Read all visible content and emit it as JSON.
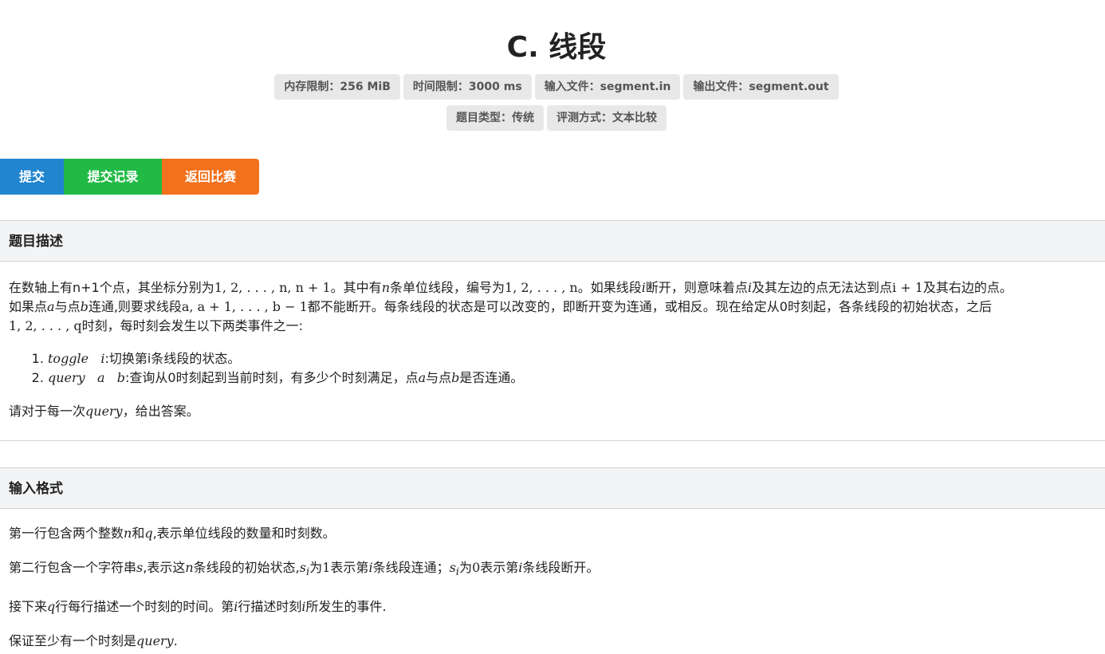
{
  "problem": {
    "title": "C. 线段"
  },
  "labels": {
    "memory": "内存限制：256 MiB",
    "time": "时间限制：3000 ms",
    "input_file": "输入文件：segment.in",
    "output_file": "输出文件：segment.out",
    "type": "题目类型：传统",
    "judge": "评测方式：文本比较"
  },
  "buttons": {
    "submit": "提交",
    "records": "提交记录",
    "back": "返回比赛"
  },
  "sections": {
    "description": {
      "header": "题目描述",
      "p1_a": "在数轴上有n+1个点，其坐标分别为",
      "p1_m1": "1, 2, . . . , n, n + 1",
      "p1_b": "。其中有",
      "p1_m2": "n",
      "p1_c": "条单位线段，编号为",
      "p1_m3": "1, 2, . . . , n",
      "p1_d": "。如果线段",
      "p1_m4": "i",
      "p1_e": "断开，则意味着点",
      "p1_m5": "i",
      "p1_f": "及其左边的点无法达到点",
      "p1_m6": "i + 1",
      "p1_g": "及其右边的点。",
      "p2_a": "如果点",
      "p2_m1": "a",
      "p2_b": "与点",
      "p2_m2": "b",
      "p2_c": "连通,则要求线段",
      "p2_m3": "a, a + 1, . . . , b − 1",
      "p2_d": "都不能断开。每条线段的状态是可以改变的，即断开变为连通，或相反。现在给定从0时刻起，各条线段的初始状态，之后",
      "p3_m1": "1, 2, . . . , q",
      "p3_a": "时刻，每时刻会发生以下两类事件之一:",
      "li1_m": "toggle   i",
      "li1_t": ":切换第i条线段的状态。",
      "li2_m": "query   a   b",
      "li2_a": ":查询从0时刻起到当前时刻，有多少个时刻满足，点",
      "li2_m2": "a",
      "li2_b": "与点",
      "li2_m3": "b",
      "li2_c": "是否连通。",
      "p4_a": "请对于每一次",
      "p4_m": "query",
      "p4_b": "，给出答案。"
    },
    "input": {
      "header": "输入格式",
      "l1_a": "第一行包含两个整数",
      "l1_m1": "n",
      "l1_b": "和",
      "l1_m2": "q",
      "l1_c": ",表示单位线段的数量和时刻数。",
      "l2_a": "第二行包含一个字符串",
      "l2_m1": "s",
      "l2_b": ",表示这",
      "l2_m2": "n",
      "l2_c": "条线段的初始状态,",
      "l2_m3": "s",
      "l2_sub1": "i",
      "l2_d": "为",
      "l2_n1": "1",
      "l2_e": "表示第",
      "l2_m4": "i",
      "l2_f": "条线段连通；",
      "l2_m5": "s",
      "l2_sub2": "i",
      "l2_g": "为",
      "l2_n2": "0",
      "l2_h": "表示第",
      "l2_m6": "i",
      "l2_i": "条线段断开。",
      "l3_a": "接下来",
      "l3_m1": "q",
      "l3_b": "行每行描述一个时刻的时间。第",
      "l3_m2": "i",
      "l3_c": "行描述时刻",
      "l3_m3": "i",
      "l3_d": "所发生的事件.",
      "l4_a": "保证至少有一个时刻是",
      "l4_m": "query",
      "l4_b": "."
    }
  }
}
